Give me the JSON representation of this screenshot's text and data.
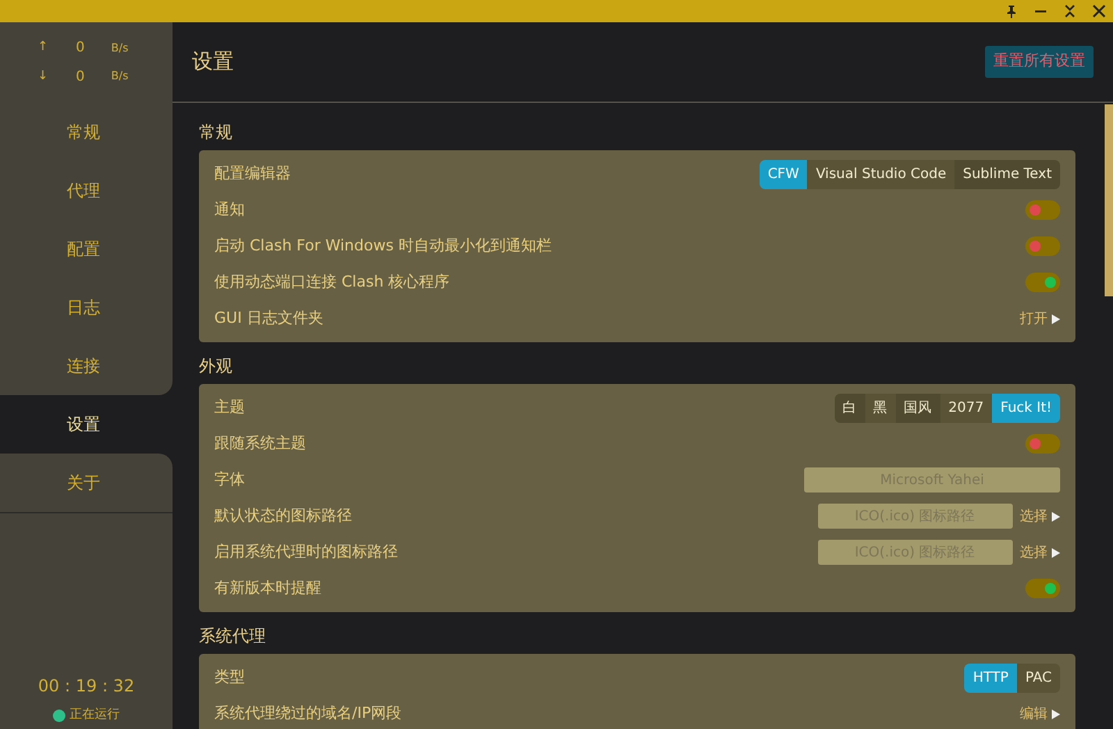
{
  "sidebar": {
    "traffic": [
      {
        "arrow": "↑",
        "value": "0",
        "unit": "B/s"
      },
      {
        "arrow": "↓",
        "value": "0",
        "unit": "B/s"
      }
    ],
    "items": [
      {
        "label": "常规",
        "selected": false
      },
      {
        "label": "代理",
        "selected": false
      },
      {
        "label": "配置",
        "selected": false
      },
      {
        "label": "日志",
        "selected": false
      },
      {
        "label": "连接",
        "selected": false
      },
      {
        "label": "设置",
        "selected": true
      },
      {
        "label": "关于",
        "selected": false
      }
    ],
    "timer": "00 : 19 : 32",
    "status": "正在运行"
  },
  "header": {
    "title": "设置",
    "reset_button": "重置所有设置"
  },
  "sections": [
    {
      "title": "常规",
      "rows": [
        {
          "kind": "segmented",
          "label": "配置编辑器",
          "options": [
            {
              "label": "CFW",
              "selected": true
            },
            {
              "label": "Visual Studio Code",
              "selected": false
            },
            {
              "label": "Sublime Text",
              "selected": false
            }
          ]
        },
        {
          "kind": "toggle",
          "label": "通知",
          "on": false
        },
        {
          "kind": "toggle",
          "label": "启动 Clash For Windows 时自动最小化到通知栏",
          "on": false
        },
        {
          "kind": "toggle",
          "label": "使用动态端口连接 Clash 核心程序",
          "on": true
        },
        {
          "kind": "link",
          "label": "GUI 日志文件夹",
          "action": "打开"
        }
      ]
    },
    {
      "title": "外观",
      "rows": [
        {
          "kind": "segmented",
          "label": "主题",
          "options": [
            {
              "label": "白",
              "selected": false
            },
            {
              "label": "黑",
              "selected": false
            },
            {
              "label": "国风",
              "selected": false
            },
            {
              "label": "2077",
              "selected": false
            },
            {
              "label": "Fuck It!",
              "selected": true
            }
          ]
        },
        {
          "kind": "toggle",
          "label": "跟随系统主题",
          "on": false
        },
        {
          "kind": "input",
          "label": "字体",
          "placeholder": "Microsoft Yahei"
        },
        {
          "kind": "input",
          "label": "默认状态的图标路径",
          "placeholder": "ICO(.ico) 图标路径",
          "action": "选择"
        },
        {
          "kind": "input",
          "label": "启用系统代理时的图标路径",
          "placeholder": "ICO(.ico) 图标路径",
          "action": "选择"
        },
        {
          "kind": "toggle",
          "label": "有新版本时提醒",
          "on": true
        }
      ]
    },
    {
      "title": "系统代理",
      "rows": [
        {
          "kind": "segmented",
          "label": "类型",
          "options": [
            {
              "label": "HTTP",
              "selected": true
            },
            {
              "label": "PAC",
              "selected": false
            }
          ]
        },
        {
          "kind": "link",
          "label": "系统代理绕过的域名/IP网段",
          "action": "编辑"
        }
      ]
    }
  ]
}
